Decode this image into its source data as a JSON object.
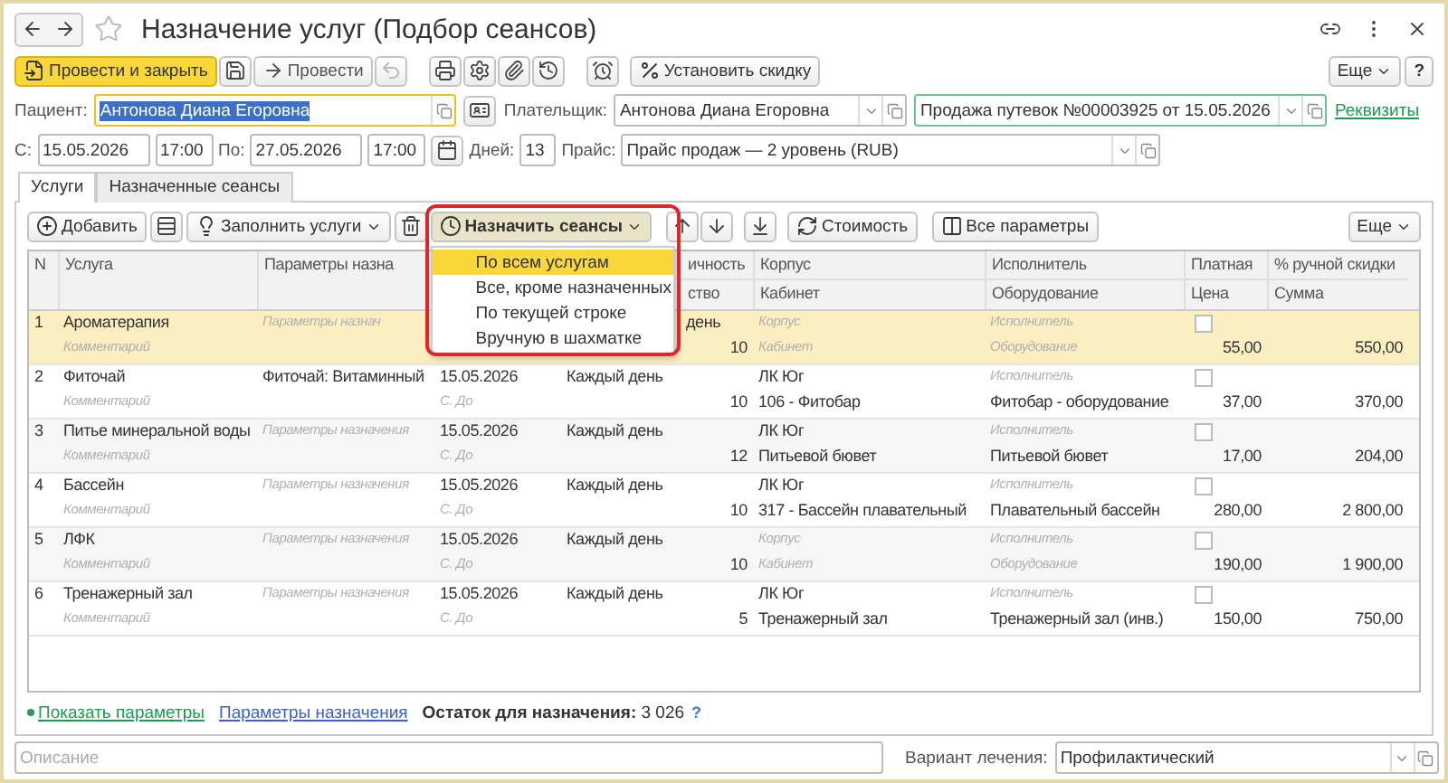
{
  "window": {
    "title": "Назначение услуг (Подбор сеансов)"
  },
  "commands": [
    {
      "kind": "primary",
      "label": "Провести и закрыть"
    },
    {
      "kind": "save"
    },
    {
      "kind": "post",
      "label": "Провести"
    },
    {
      "kind": "undo",
      "disabled": true
    }
  ],
  "command_icons": [
    {
      "kind": "print"
    },
    {
      "kind": "settings"
    },
    {
      "kind": "attach"
    },
    {
      "kind": "history"
    }
  ],
  "discount_button": "Установить скидку",
  "more_button": "Еще",
  "help_button": "?",
  "patient": {
    "label": "Пациент:",
    "value": "Антонова Диана Егоровна",
    "focused": true,
    "highlighted": true
  },
  "payer": {
    "label": "Плательщик:",
    "value": "Антонова Диана Егоровна"
  },
  "document": {
    "value": "Продажа путевок №00003925 от 15.05.2026"
  },
  "details_link": "Реквизиты",
  "period": {
    "from_label": "С:",
    "from_date": "15.05.2026",
    "from_time": "17:00",
    "to_label": "По:",
    "to_date": "27.05.2026",
    "to_time": "17:00",
    "days_label": "Дней:",
    "days": "13"
  },
  "price_list": {
    "label": "Прайс:",
    "value": "Прайс продаж — 2 уровень (RUB)"
  },
  "tabs": [
    {
      "label": "Услуги",
      "selected": true
    },
    {
      "label": "Назначенные сеансы",
      "selected": false
    }
  ],
  "toolbar": {
    "add": "Добавить",
    "fill": "Заполнить услуги",
    "assign": "Назначить сеансы",
    "cost": "Стоимость",
    "all_params": "Все параметры",
    "more": "Еще"
  },
  "assign_menu": [
    {
      "label": "По всем услугам",
      "selected": true
    },
    {
      "label": "Все, кроме назначенных",
      "selected": false
    },
    {
      "label": "По текущей строке",
      "selected": false
    },
    {
      "label": "Вручную в шахматке",
      "selected": false
    }
  ],
  "table": {
    "columns": [
      {
        "label": "N"
      },
      {
        "label": "Услуга"
      },
      {
        "label": "Параметры назна"
      },
      {
        "label": "ичность",
        "sub": "ство"
      },
      {
        "label": "Корпус",
        "sub": "Кабинет"
      },
      {
        "label": "Исполнитель",
        "sub": "Оборудование"
      },
      {
        "label": "Платная",
        "sub": "Цена"
      },
      {
        "label": "% ручной скидки",
        "sub": "Сумма"
      }
    ],
    "rows": [
      {
        "n": "1",
        "selected": true,
        "service": {
          "value": "Ароматерапия"
        },
        "comment": {
          "placeholder": "Комментарий"
        },
        "params": {
          "placeholder": "Параметры назнач"
        },
        "frequency": "день",
        "quantity": "10",
        "building": {
          "placeholder": "Корпус"
        },
        "room": {
          "placeholder": "Кабинет"
        },
        "executor": {
          "placeholder": "Исполнитель"
        },
        "equipment": {
          "placeholder": "Оборудование"
        },
        "paid": false,
        "price": "55,00",
        "amount": "550,00"
      },
      {
        "n": "2",
        "selected": false,
        "service": {
          "value": "Фиточай"
        },
        "comment": {
          "placeholder": "Комментарий"
        },
        "params": {
          "value": "Фиточай: Витаминный"
        },
        "date": "15.05.2026",
        "range": {
          "placeholder": "С. До"
        },
        "frequency": "Каждый день",
        "quantity": "10",
        "building": {
          "value": "ЛК Юг"
        },
        "room": {
          "value": "106 - Фитобар"
        },
        "executor": {
          "placeholder": "Исполнитель"
        },
        "equipment": {
          "value": "Фитобар - оборудование"
        },
        "paid": false,
        "price": "37,00",
        "amount": "370,00"
      },
      {
        "n": "3",
        "selected": false,
        "service": {
          "value": "Питье минеральной воды"
        },
        "comment": {
          "placeholder": "Комментарий"
        },
        "params": {
          "placeholder": "Параметры назначения"
        },
        "date": "15.05.2026",
        "range": {
          "placeholder": "С. До"
        },
        "frequency": "Каждый день",
        "quantity": "12",
        "building": {
          "value": "ЛК Юг"
        },
        "room": {
          "value": "Питьевой бювет"
        },
        "executor": {
          "placeholder": "Исполнитель"
        },
        "equipment": {
          "value": "Питьевой бювет"
        },
        "paid": false,
        "price": "17,00",
        "amount": "204,00"
      },
      {
        "n": "4",
        "selected": false,
        "service": {
          "value": "Бассейн"
        },
        "comment": {
          "placeholder": "Комментарий"
        },
        "params": {
          "placeholder": "Параметры назначения"
        },
        "date": "15.05.2026",
        "range": {
          "placeholder": "С. До"
        },
        "frequency": "Каждый день",
        "quantity": "10",
        "building": {
          "value": "ЛК Юг"
        },
        "room": {
          "value": "317 - Бассейн плавательный"
        },
        "executor": {
          "placeholder": "Исполнитель"
        },
        "equipment": {
          "value": "Плавательный бассейн"
        },
        "paid": false,
        "price": "280,00",
        "amount": "2 800,00"
      },
      {
        "n": "5",
        "selected": false,
        "service": {
          "value": "ЛФК"
        },
        "comment": {
          "placeholder": "Комментарий"
        },
        "params": {
          "placeholder": "Параметры назначения"
        },
        "date": "15.05.2026",
        "range": {
          "placeholder": "С. До"
        },
        "frequency": "Каждый день",
        "quantity": "10",
        "building": {
          "placeholder": "Корпус"
        },
        "room": {
          "placeholder": "Кабинет"
        },
        "executor": {
          "placeholder": "Исполнитель"
        },
        "equipment": {
          "placeholder": "Оборудование"
        },
        "paid": false,
        "price": "190,00",
        "amount": "1 900,00"
      },
      {
        "n": "6",
        "selected": false,
        "service": {
          "value": "Тренажерный зал"
        },
        "comment": {
          "placeholder": "Комментарий"
        },
        "params": {
          "placeholder": "Параметры назначения"
        },
        "date": "15.05.2026",
        "range": {
          "placeholder": "С. До"
        },
        "frequency": "Каждый день",
        "quantity": "5",
        "building": {
          "value": "ЛК Юг"
        },
        "room": {
          "value": "Тренажерный зал"
        },
        "executor": {
          "placeholder": "Исполнитель"
        },
        "equipment": {
          "value": "Тренажерный зал (инв.)"
        },
        "paid": false,
        "price": "150,00",
        "amount": "750,00"
      }
    ]
  },
  "links": {
    "show_params": "Показать параметры",
    "assign_params": "Параметры назначения",
    "remainder": "**Остаток для назначения:** 3 026",
    "help": "?"
  },
  "description": {
    "placeholder": "Описание"
  },
  "treatment": {
    "label": "Вариант лечения:",
    "value": "Профилактический"
  }
}
